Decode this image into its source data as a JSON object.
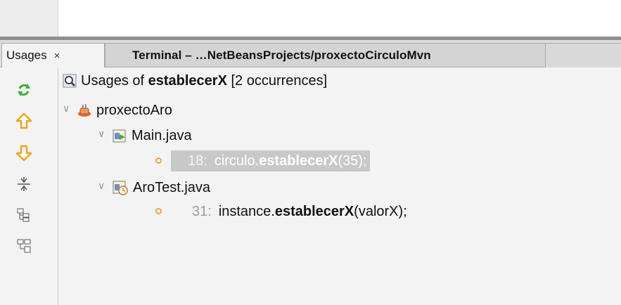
{
  "tabs": {
    "usages_label": "Usages",
    "usages_close": "×",
    "terminal_label": "Terminal – …NetBeansProjects/proxectoCirculoMvn"
  },
  "toolbar": {
    "buttons": [
      "refresh-icon",
      "previous-occurrence-icon",
      "next-occurrence-icon",
      "collapse-all-icon",
      "logical-view-icon",
      "physical-view-icon"
    ]
  },
  "results": {
    "header_prefix": "Usages of ",
    "header_symbol": "establecerX",
    "header_suffix": " [2 occurrences]",
    "project": "proxectoAro",
    "files": [
      {
        "name": "Main.java",
        "usage": {
          "line": "18:",
          "before": "circulo.",
          "symbol": "establecerX",
          "after": "(35);"
        }
      },
      {
        "name": "AroTest.java",
        "usage": {
          "line": "31:",
          "before": "instance.",
          "symbol": "establecerX",
          "after": "(valorX);"
        }
      }
    ]
  },
  "colors": {
    "accent_bullet": "#f0a040",
    "selection": "#c8c8c8",
    "arrow": "#f2a21a",
    "refresh": "#3fae3f"
  }
}
